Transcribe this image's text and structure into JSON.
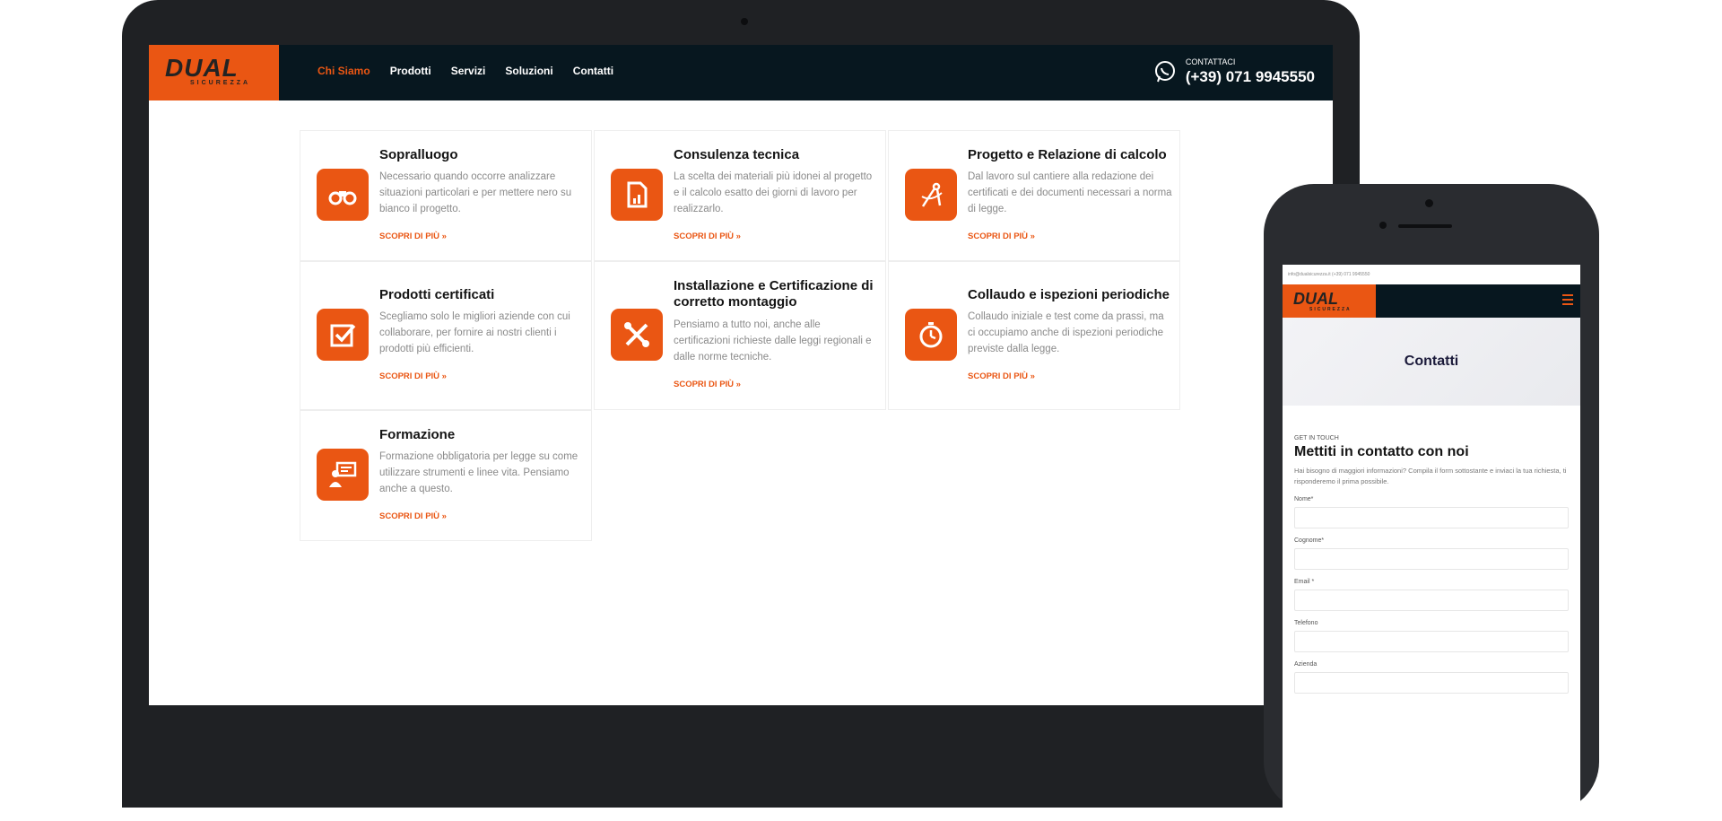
{
  "laptop": {
    "nav": {
      "logo": "DUAL",
      "logo_sub": "SICUREZZA",
      "items": [
        {
          "label": "Chi Siamo",
          "active": true
        },
        {
          "label": "Prodotti"
        },
        {
          "label": "Servizi"
        },
        {
          "label": "Soluzioni"
        },
        {
          "label": "Contatti"
        }
      ],
      "contact_label": "CONTATTACI",
      "contact_phone": "(+39) 071 9945550",
      "whatsapp_icon": "whatsapp-icon"
    },
    "cards": [
      {
        "title": "Sopralluogo",
        "desc": "Necessario quando occorre analizzare situazioni particolari e per mettere nero su bianco il progetto.",
        "more": "SCOPRI DI PIÙ »",
        "icon": "binoculars-icon"
      },
      {
        "title": "Consulenza tecnica",
        "desc": "La scelta dei materiali più idonei al progetto e il calcolo esatto dei giorni di lavoro per realizzarlo.",
        "more": "SCOPRI DI PIÙ »",
        "icon": "document-chart-icon"
      },
      {
        "title": "Progetto e Relazione di calcolo",
        "desc": "Dal lavoro sul cantiere alla redazione dei certificati e dei documenti necessari a norma di legge.",
        "more": "SCOPRI DI PIÙ »",
        "icon": "compass-icon"
      },
      {
        "title": "Prodotti certificati",
        "desc": "Scegliamo solo le migliori aziende con cui collaborare, per fornire ai nostri clienti i prodotti più efficienti.",
        "more": "SCOPRI DI PIÙ »",
        "icon": "checkbox-icon"
      },
      {
        "title": "Installazione e Certificazione di corretto montaggio",
        "desc": "Pensiamo a tutto noi, anche alle certificazioni richieste dalle leggi regionali e dalle norme tecniche.",
        "more": "SCOPRI DI PIÙ »",
        "icon": "tools-icon"
      },
      {
        "title": "Collaudo e ispezioni periodiche",
        "desc": "Collaudo iniziale e test come da prassi, ma ci occupiamo anche di ispezioni periodiche previste dalla legge.",
        "more": "SCOPRI DI PIÙ »",
        "icon": "stopwatch-icon"
      },
      {
        "title": "Formazione",
        "desc": "Formazione obbligatoria per legge su come utilizzare strumenti e linee vita. Pensiamo anche a questo.",
        "more": "SCOPRI DI PIÙ »",
        "icon": "presentation-icon"
      }
    ]
  },
  "phone": {
    "topbar": "info@dualsicurezza.it   (+39) 071 9945550",
    "logo": "DUAL",
    "logo_sub": "SICUREZZA",
    "hero_title": "Contatti",
    "kicker": "GET IN TOUCH",
    "heading": "Mettiti in contatto con noi",
    "subtext": "Hai bisogno di maggiori informazioni? Compila il form sottostante e inviaci la tua richiesta, ti risponderemo il prima possibile.",
    "fields": [
      {
        "label": "Nome*"
      },
      {
        "label": "Cognome*"
      },
      {
        "label": "Email *"
      },
      {
        "label": "Telefono"
      },
      {
        "label": "Azienda"
      }
    ]
  },
  "colors": {
    "accent": "#ea5613",
    "nav_bg": "#07171f",
    "device": "#1f2124"
  }
}
